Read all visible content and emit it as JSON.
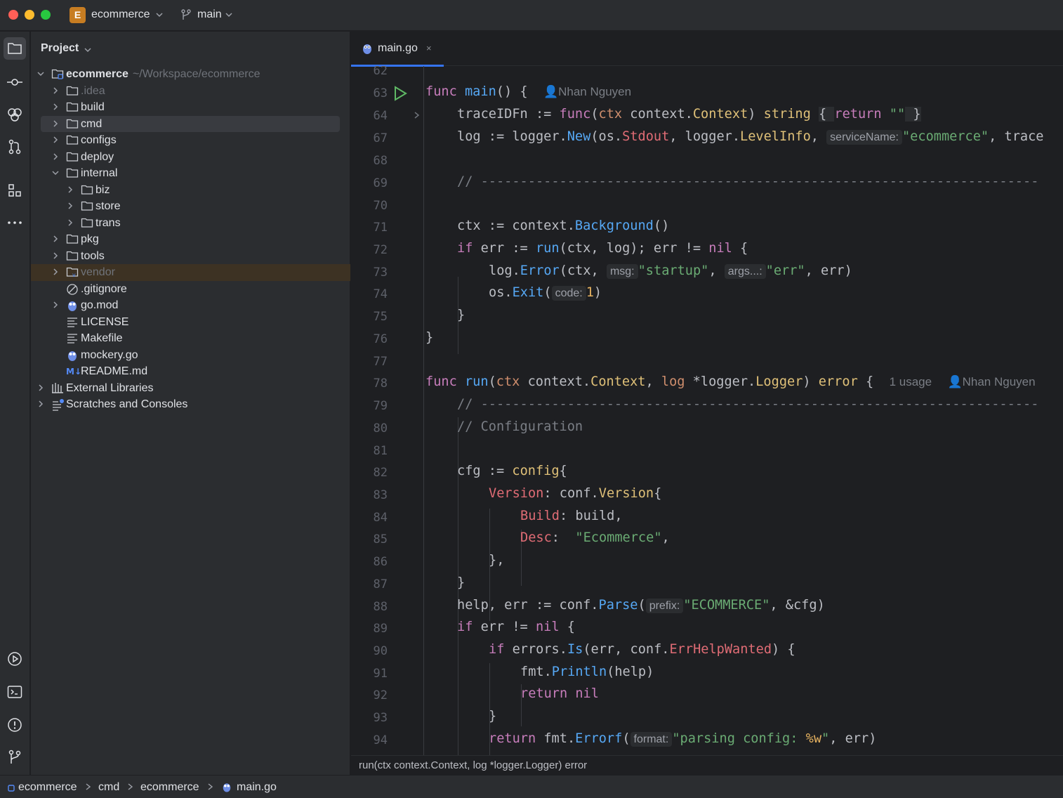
{
  "titlebar": {
    "project_badge": "E",
    "project_name": "ecommerce",
    "branch_name": "main"
  },
  "project_panel": {
    "title": "Project",
    "tree": [
      {
        "label": "ecommerce",
        "path": "~/Workspace/ecommerce"
      },
      {
        "label": ".idea"
      },
      {
        "label": "build"
      },
      {
        "label": "cmd"
      },
      {
        "label": "configs"
      },
      {
        "label": "deploy"
      },
      {
        "label": "internal"
      },
      {
        "label": "biz"
      },
      {
        "label": "store"
      },
      {
        "label": "trans"
      },
      {
        "label": "pkg"
      },
      {
        "label": "tools"
      },
      {
        "label": "vendor"
      },
      {
        "label": ".gitignore"
      },
      {
        "label": "go.mod"
      },
      {
        "label": "LICENSE"
      },
      {
        "label": "Makefile"
      },
      {
        "label": "mockery.go"
      },
      {
        "label": "README.md"
      },
      {
        "label": "External Libraries"
      },
      {
        "label": "Scratches and Consoles"
      }
    ]
  },
  "editor": {
    "tab_label": "main.go",
    "tab_close": "×",
    "line_numbers": [
      "62",
      "63",
      "64",
      "67",
      "68",
      "69",
      "70",
      "71",
      "72",
      "73",
      "74",
      "75",
      "76",
      "77",
      "78",
      "79",
      "80",
      "81",
      "82",
      "83",
      "84",
      "85",
      "86",
      "87",
      "88",
      "89",
      "90",
      "91",
      "92",
      "93",
      "94"
    ],
    "inlay": {
      "author_1": "Nhan Nguyen",
      "service_name_hint": "serviceName:",
      "msg_hint": "msg:",
      "args_hint": "args...:",
      "code_hint": "code:",
      "usages": "1 usage",
      "author_2": "Nhan Nguyen",
      "prefix_hint": "prefix:",
      "format_hint": "format:"
    }
  },
  "signature_bar": {
    "text": "run(ctx context.Context, log *logger.Logger) error"
  },
  "breadcrumbs": [
    "ecommerce",
    "cmd",
    "ecommerce",
    "main.go"
  ],
  "colors": {
    "accent": "#3574f0",
    "keyword": "#c77dbb",
    "function": "#56a8f5",
    "string": "#6aab73",
    "type": "#dfc078",
    "comment": "#7a7e85"
  }
}
